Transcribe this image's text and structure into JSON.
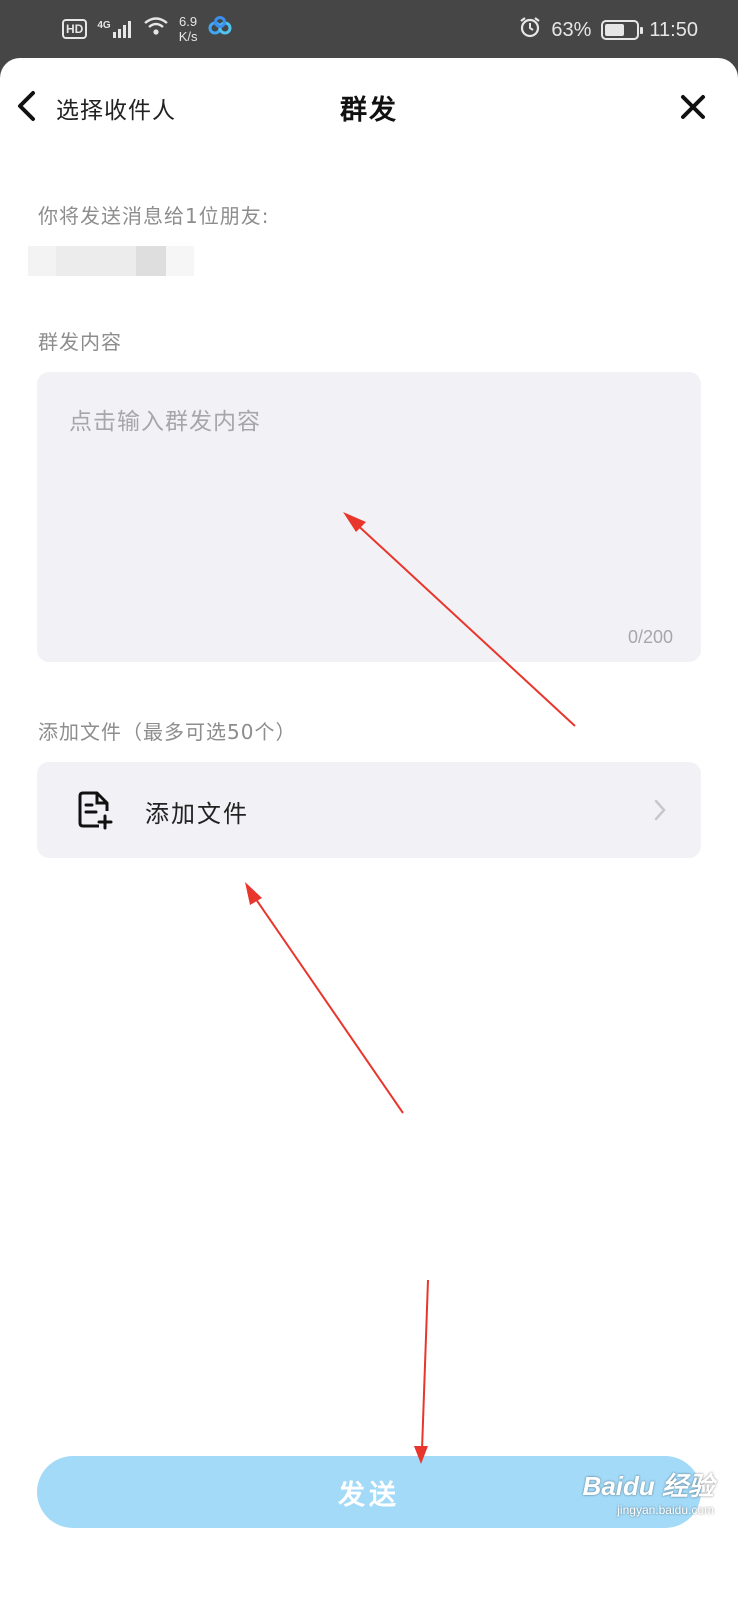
{
  "status_bar": {
    "hd": "HD",
    "network": "4G",
    "speed_value": "6.9",
    "speed_unit": "K/s",
    "battery_percent": "63%",
    "battery_level": 0.63,
    "time": "11:50"
  },
  "nav": {
    "back_label": "选择收件人",
    "title": "群发"
  },
  "recipients": {
    "label": "你将发送消息给1位朋友:"
  },
  "content": {
    "section_label": "群发内容",
    "placeholder": "点击输入群发内容",
    "counter": "0/200"
  },
  "files": {
    "section_label": "添加文件（最多可选50个）",
    "row_label": "添加文件"
  },
  "send": {
    "label": "发送"
  },
  "watermark": {
    "main": "Baidu 经验",
    "sub": "jingyan.baidu.com"
  },
  "colors": {
    "send_button": "#a2daf8",
    "input_background": "#f2f2f6",
    "annotation_arrow": "#e8362c"
  },
  "icons": {
    "back": "chevron-left-icon",
    "close": "close-icon",
    "add_file": "file-add-icon",
    "row_arrow": "chevron-right-icon"
  }
}
